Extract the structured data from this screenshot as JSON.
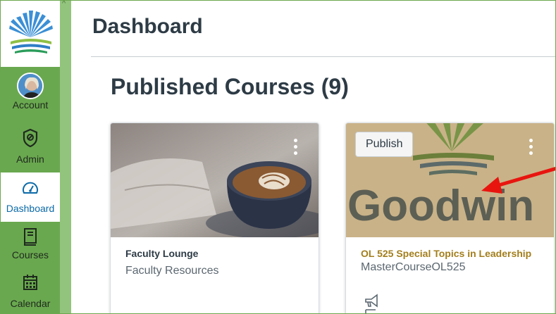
{
  "nav": {
    "items": [
      {
        "label": "Account",
        "icon": "avatar"
      },
      {
        "label": "Admin",
        "icon": "shield-icon"
      },
      {
        "label": "Dashboard",
        "icon": "dashboard-gauge-icon",
        "active": true
      },
      {
        "label": "Courses",
        "icon": "book-icon"
      },
      {
        "label": "Calendar",
        "icon": "calendar-icon"
      }
    ]
  },
  "header": {
    "title": "Dashboard"
  },
  "section": {
    "title": "Published Courses (9)"
  },
  "cards": [
    {
      "name": "Faculty Lounge",
      "code": "Faculty Resources",
      "name_color": "#2d3b45"
    },
    {
      "name": "OL 525 Special Topics in Leadership",
      "code": "MasterCourseOL525",
      "name_color": "#a27e1b",
      "publish_label": "Publish",
      "image_text": "Goodwin"
    }
  ],
  "colors": {
    "nav_bg": "#6aa84f",
    "accent": "#0b6aa8",
    "arrow": "#e8150f"
  }
}
